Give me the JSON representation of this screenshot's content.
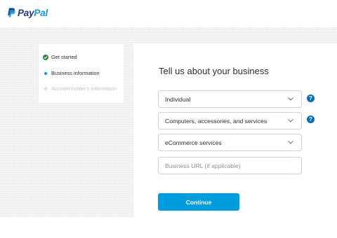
{
  "brand": {
    "logo_part1": "Pay",
    "logo_part2": "Pal"
  },
  "steps": [
    {
      "label": "Get started",
      "state": "done"
    },
    {
      "label": "Business information",
      "state": "active"
    },
    {
      "label": "Account holder's information",
      "state": "pending"
    }
  ],
  "form": {
    "heading": "Tell us about your business",
    "business_type": "Individual",
    "category": "Computers, accessories, and services",
    "subcategory": "eCommerce services",
    "url_placeholder": "Business URL (if applicable)",
    "help_label": "?",
    "continue_label": "Continue"
  },
  "colors": {
    "accent": "#009cde",
    "help": "#0070ba",
    "success": "#2b8a3e"
  }
}
